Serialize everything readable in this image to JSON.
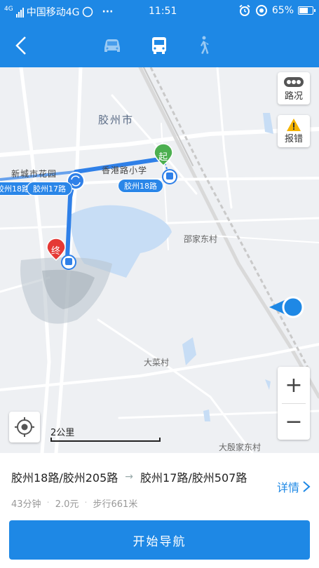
{
  "status_bar": {
    "network": "4G",
    "carrier": "中国移动4G",
    "more": "···",
    "time": "11:51",
    "battery": "65%"
  },
  "header": {
    "modes": [
      "car-icon",
      "bus-icon",
      "walk-icon"
    ],
    "active_mode": "bus"
  },
  "map": {
    "city_label": "胶州市",
    "labels": {
      "garden": "新城市花园",
      "school": "香港路小学",
      "village1": "邵家东村",
      "village2": "大菜村",
      "village3": "大殷家东村"
    },
    "pills": [
      "胶州18路",
      "胶州17路",
      "胶州18路"
    ],
    "start_label": "起",
    "end_label": "终",
    "traffic_label": "路况",
    "report_label": "报错",
    "scale_label": "2公里",
    "zoom_in": "+",
    "zoom_out": "−"
  },
  "route": {
    "title_a": "胶州18路/胶州205路",
    "title_b": "胶州17路/胶州507路",
    "details_label": "详情",
    "duration": "43分钟",
    "price": "2.0元",
    "walk": "步行661米"
  },
  "start_nav_label": "开始导航",
  "colors": {
    "accent": "#1e88e5",
    "route": "#3d8ee8",
    "start": "#4caf50",
    "end": "#e53935"
  }
}
